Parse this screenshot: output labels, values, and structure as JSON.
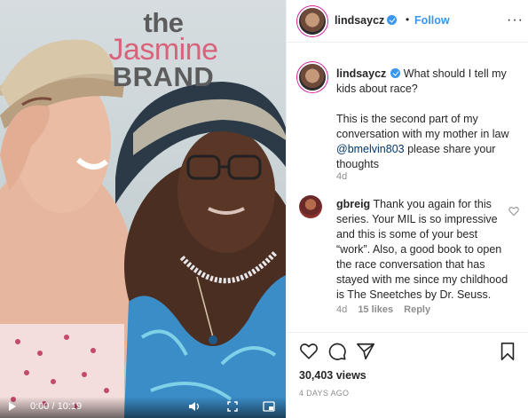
{
  "video": {
    "watermark": {
      "line1": "the",
      "line2": "Jasmine",
      "line3": "BRAND"
    },
    "time": "0:00 / 10:19",
    "icons": [
      "play-icon",
      "volume-icon",
      "fullscreen-icon",
      "pip-icon"
    ]
  },
  "header": {
    "username": "lindsaycz",
    "separator": "•",
    "follow_label": "Follow",
    "more_label": "···"
  },
  "caption": {
    "username": "lindsaycz",
    "text1": "What should I tell my kids about race?",
    "text2_before": "This is the second part of my conversation with my mother in law ",
    "mention": "@bmelvin803",
    "text2_after": " please share your thoughts",
    "age": "4d"
  },
  "comment": {
    "username": "gbreig",
    "text": "Thank you again for this series. Your MIL is so impressive and this is some of your best “work”. Also, a good book to open the race conversation that has stayed with me since my childhood is The Sneetches by Dr. Seuss.",
    "age": "4d",
    "likes": "15 likes",
    "reply": "Reply"
  },
  "actions": {
    "icons": [
      "heart-icon",
      "comment-icon",
      "share-icon",
      "bookmark-icon"
    ],
    "views": "30,403 views",
    "posted": "4 DAYS AGO"
  },
  "colors": {
    "accent": "#3897f0",
    "text": "#262626",
    "muted": "#8e8e8e",
    "watermark_pink": "#d9637b",
    "watermark_grey": "#5c5c5c"
  }
}
